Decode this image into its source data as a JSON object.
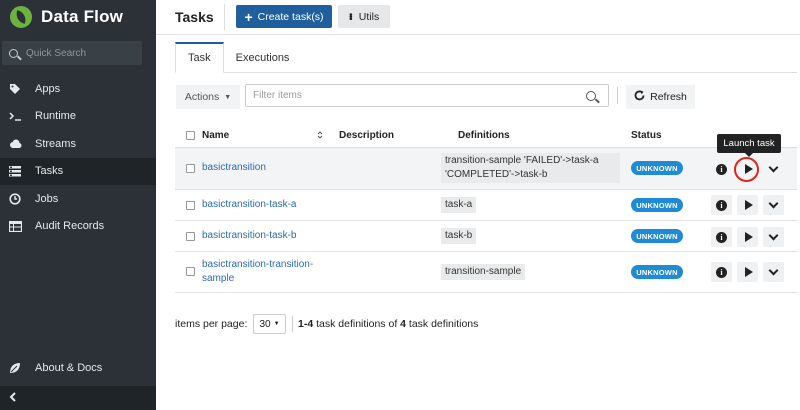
{
  "sidebar": {
    "brand": "Data Flow",
    "search_placeholder": "Quick Search",
    "items": [
      {
        "label": "Apps",
        "icon": "tag-icon"
      },
      {
        "label": "Runtime",
        "icon": "terminal-icon"
      },
      {
        "label": "Streams",
        "icon": "cloud-icon"
      },
      {
        "label": "Tasks",
        "icon": "tasks-icon",
        "active": true
      },
      {
        "label": "Jobs",
        "icon": "clock-icon"
      },
      {
        "label": "Audit Records",
        "icon": "table-icon"
      }
    ],
    "about": "About & Docs",
    "collapse_icon": "chevron-left-icon"
  },
  "header": {
    "title": "Tasks",
    "create_label": "Create task(s)",
    "utils_label": "Utils"
  },
  "tabs": [
    {
      "label": "Task",
      "active": true
    },
    {
      "label": "Executions",
      "active": false
    }
  ],
  "toolbar": {
    "actions_label": "Actions",
    "filter_placeholder": "Filter items",
    "refresh_label": "Refresh"
  },
  "table": {
    "columns": {
      "name": "Name",
      "description": "Description",
      "definitions": "Definitions",
      "status": "Status"
    },
    "rows": [
      {
        "name": "basictransition",
        "definition_lines": [
          "transition-sample 'FAILED'->task-a",
          "'COMPLETED'->task-b"
        ],
        "status": "UNKNOWN"
      },
      {
        "name": "basictransition-task-a",
        "definition_lines": [
          "task-a"
        ],
        "status": "UNKNOWN"
      },
      {
        "name": "basictransition-task-b",
        "definition_lines": [
          "task-b"
        ],
        "status": "UNKNOWN"
      },
      {
        "name_lines": [
          "basictransition-transition-",
          "sample"
        ],
        "definition_lines": [
          "transition-sample"
        ],
        "status": "UNKNOWN"
      }
    ],
    "tooltip": "Launch task",
    "highlight_color": "#e0241b"
  },
  "pagination": {
    "label": "items per page:",
    "page_size": "30",
    "range": "1-4",
    "text_mid": " task definitions of ",
    "total": "4",
    "text_end": " task definitions"
  },
  "colors": {
    "sidebar_bg": "#2b3136",
    "primary": "#1f5f9e",
    "link": "#2a6ab0",
    "badge": "#1f8bd6"
  }
}
